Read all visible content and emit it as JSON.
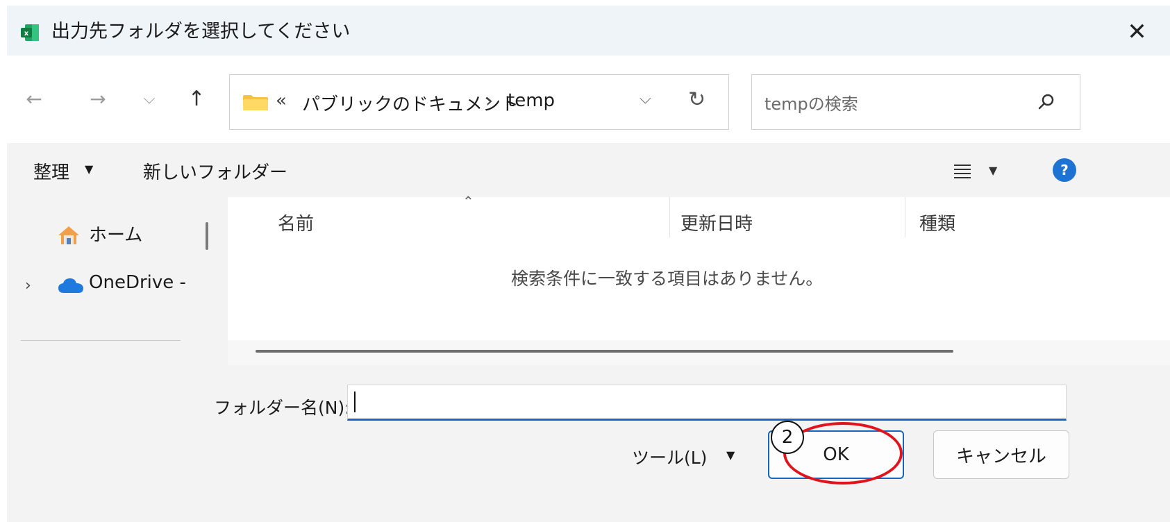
{
  "dialog": {
    "title": "出力先フォルダを選択してください",
    "close_glyph": "✕",
    "app_icon": "excel-icon"
  },
  "nav": {
    "back_glyph": "←",
    "forward_glyph": "→",
    "recent_glyph": "⌵",
    "up_glyph": "↑",
    "overflow_glyph": "«",
    "breadcrumbs": [
      "パブリックのドキュメント",
      "temp"
    ],
    "separator_glyph": "›",
    "dropdown_glyph": "⌵",
    "refresh_glyph": "↻"
  },
  "search": {
    "placeholder": "tempの検索",
    "icon": "search-icon"
  },
  "toolbar": {
    "organize_label": "整理",
    "dropdown_glyph": "▼",
    "new_folder_label": "新しいフォルダー",
    "view_icon": "list-view-icon",
    "help_label": "?"
  },
  "sidebar": {
    "items": [
      {
        "label": "ホーム",
        "icon": "home-icon"
      },
      {
        "label": "OneDrive - ",
        "icon": "cloud-icon",
        "expand_glyph": "›"
      }
    ]
  },
  "filelist": {
    "sort_glyph": "⌃",
    "columns": [
      "名前",
      "更新日時",
      "種類"
    ],
    "empty_message": "検索条件に一致する項目はありません。"
  },
  "footer": {
    "folder_name_label": "フォルダー名(N):",
    "folder_name_value": "",
    "tools_label": "ツール(L)",
    "tools_dropdown_glyph": "▼",
    "ok_label": "OK",
    "cancel_label": "キャンセル"
  },
  "annotation": {
    "step_number": "2",
    "highlight_color": "#e0141c"
  },
  "colors": {
    "accent": "#1865c0",
    "help": "#1e73d2",
    "folder": "#f5c242",
    "onedrive": "#1f7ae0"
  }
}
